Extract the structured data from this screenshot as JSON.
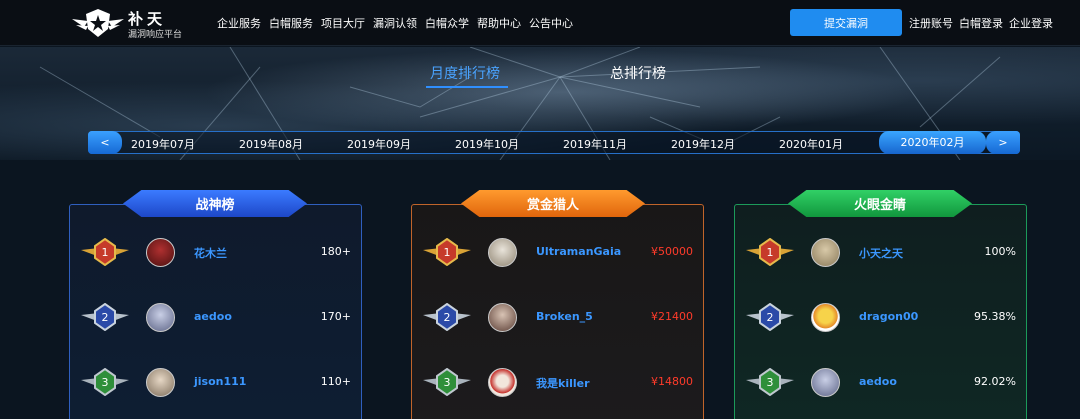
{
  "header": {
    "logo_title": "补天",
    "logo_subtitle": "漏洞响应平台",
    "nav": [
      "企业服务",
      "白帽服务",
      "项目大厅",
      "漏洞认领",
      "白帽众学",
      "帮助中心",
      "公告中心"
    ],
    "submit_label": "提交漏洞",
    "account": [
      "注册账号",
      "白帽登录",
      "企业登录"
    ]
  },
  "tabs": {
    "monthly": "月度排行榜",
    "total": "总排行榜",
    "active": "monthly"
  },
  "months": {
    "prev_icon": "<",
    "next_icon": ">",
    "items": [
      "2019年07月",
      "2019年08月",
      "2019年09月",
      "2019年10月",
      "2019年11月",
      "2019年12月",
      "2020年01月",
      "2020年02月"
    ],
    "selected": "2020年02月"
  },
  "boards": [
    {
      "title": "战神榜",
      "theme": "#2f5fbf",
      "rows": [
        {
          "rank": "1",
          "name": "花木兰",
          "value": "180+"
        },
        {
          "rank": "2",
          "name": "aedoo",
          "value": "170+"
        },
        {
          "rank": "3",
          "name": "jison111",
          "value": "110+"
        }
      ]
    },
    {
      "title": "赏金猎人",
      "theme": "#c0642a",
      "rows": [
        {
          "rank": "1",
          "name": "UltramanGaia",
          "value": "¥50000"
        },
        {
          "rank": "2",
          "name": "Broken_5",
          "value": "¥21400"
        },
        {
          "rank": "3",
          "name": "我是killer",
          "value": "¥14800"
        }
      ]
    },
    {
      "title": "火眼金睛",
      "theme": "#1c9a5a",
      "rows": [
        {
          "rank": "1",
          "name": "小天之天",
          "value": "100%"
        },
        {
          "rank": "2",
          "name": "dragon00",
          "value": "95.38%"
        },
        {
          "rank": "3",
          "name": "aedoo",
          "value": "92.02%"
        }
      ]
    }
  ],
  "colors": {
    "accent": "#1f8cf0",
    "money": "#ff3b2a",
    "username": "#3b97ff"
  }
}
